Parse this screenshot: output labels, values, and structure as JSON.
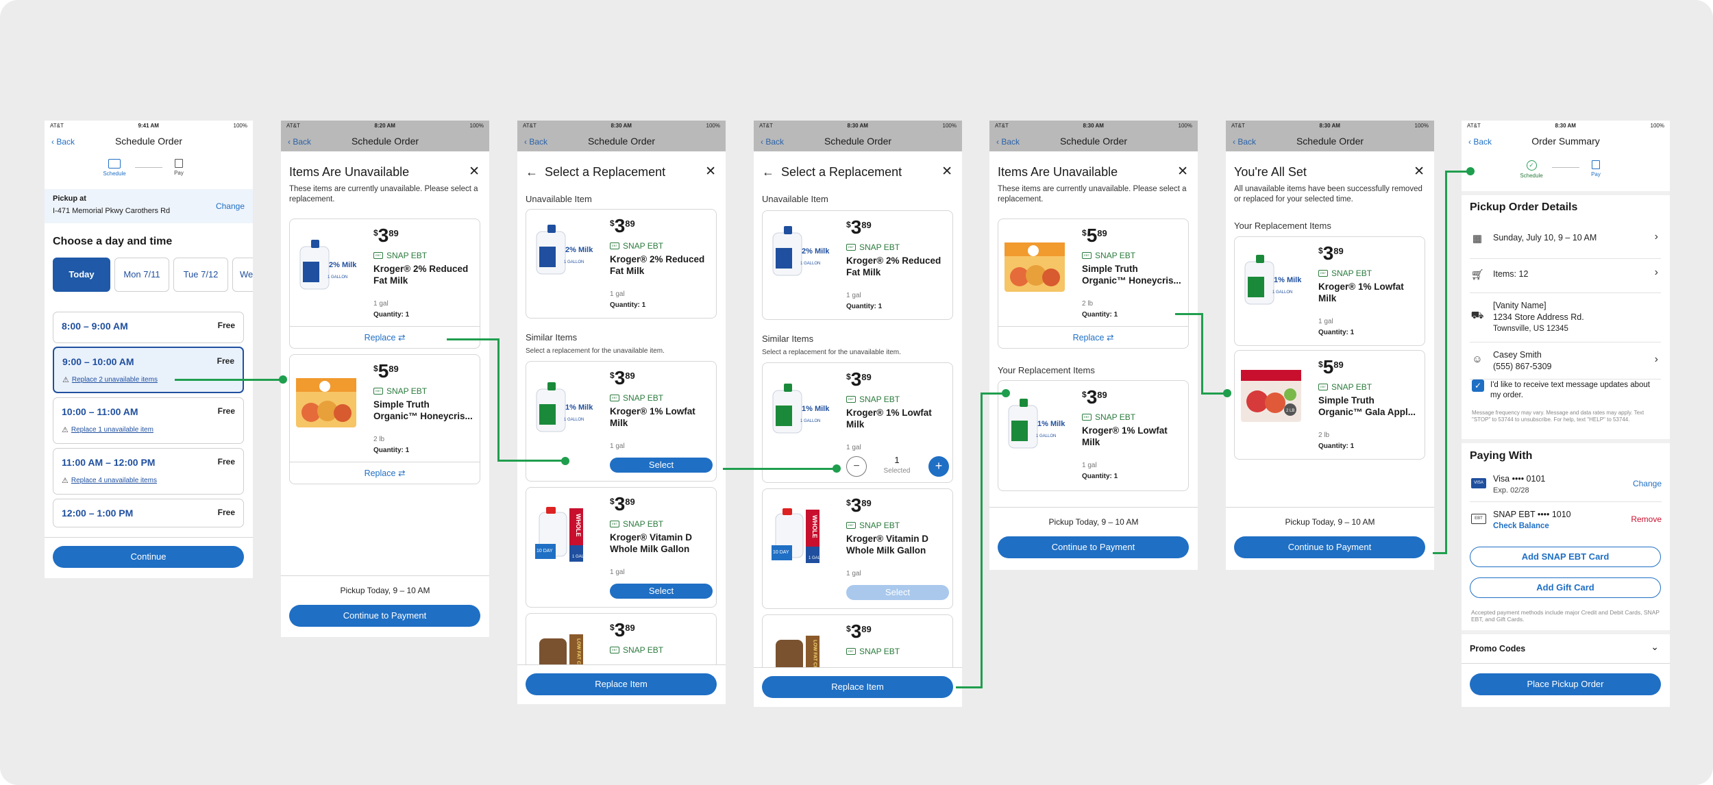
{
  "status": {
    "carrier": "AT&T",
    "battery": "100%",
    "time_first": "9:41 AM",
    "time_second": "8:20 AM",
    "time_rest": "8:30 AM"
  },
  "nav": {
    "back": "Back",
    "schedule_order": "Schedule Order",
    "order_summary": "Order Summary"
  },
  "steps": {
    "schedule": "Schedule",
    "pay": "Pay"
  },
  "screen1": {
    "pickup_label": "Pickup at",
    "pickup_address": "I-471 Memorial Pkwy Carothers Rd",
    "change": "Change",
    "heading": "Choose a day and time",
    "days": [
      "Today",
      "Mon 7/11",
      "Tue 7/12",
      "We"
    ],
    "slots": [
      {
        "time": "8:00 – 9:00 AM",
        "fee": "Free",
        "warning": ""
      },
      {
        "time": "9:00 – 10:00 AM",
        "fee": "Free",
        "warning": "Replace 2 unavailable items"
      },
      {
        "time": "10:00 – 11:00 AM",
        "fee": "Free",
        "warning": "Replace 1 unavailable item"
      },
      {
        "time": "11:00 AM – 12:00 PM",
        "fee": "Free",
        "warning": "Replace 4 unavailable items"
      },
      {
        "time": "12:00 – 1:00 PM",
        "fee": "Free",
        "warning": ""
      }
    ],
    "continue": "Continue"
  },
  "screen2": {
    "title": "Items Are Unavailable",
    "subtitle": "These items are currently unavailable. Please select a replacement.",
    "items": [
      {
        "dollars": "3",
        "cents": "89",
        "snap": "SNAP EBT",
        "name": "Kroger® 2% Reduced Fat Milk",
        "size": "1 gal",
        "qty": "Quantity: 1",
        "action": "Replace"
      },
      {
        "dollars": "5",
        "cents": "89",
        "snap": "SNAP EBT",
        "name": "Simple Truth Organic™ Honeycris...",
        "size": "2 lb",
        "qty": "Quantity: 1",
        "action": "Replace"
      }
    ],
    "pickup": "Pickup Today, 9 – 10 AM",
    "cta": "Continue to Payment"
  },
  "screen3": {
    "title": "Select a Replacement",
    "unavailable": "Unavailable Item",
    "similar": "Similar Items",
    "similar_sub": "Select a replacement for the unavailable item.",
    "unavail_item": {
      "dollars": "3",
      "cents": "89",
      "snap": "SNAP EBT",
      "name": "Kroger® 2% Reduced Fat Milk",
      "size": "1 gal",
      "qty": "Quantity: 1"
    },
    "options": [
      {
        "dollars": "3",
        "cents": "89",
        "snap": "SNAP EBT",
        "name": "Kroger® 1% Lowfat Milk",
        "size": "1 gal",
        "btn": "Select"
      },
      {
        "dollars": "3",
        "cents": "89",
        "snap": "SNAP EBT",
        "name": "Kroger® Vitamin D Whole Milk Gallon",
        "size": "1 gal",
        "btn": "Select"
      },
      {
        "dollars": "3",
        "cents": "89",
        "snap": "SNAP EBT"
      }
    ],
    "cta": "Replace Item"
  },
  "screen4": {
    "stepper_value": "1",
    "stepper_label": "Selected",
    "disabled_select": "Select"
  },
  "screen5": {
    "title": "Items Are Unavailable",
    "subtitle": "These items are currently unavailable. Please select a replacement.",
    "item": {
      "dollars": "5",
      "cents": "89",
      "snap": "SNAP EBT",
      "name": "Simple Truth Organic™ Honeycris...",
      "size": "2 lb",
      "qty": "Quantity: 1",
      "action": "Replace"
    },
    "your_repl": "Your Replacement Items",
    "repl_item": {
      "dollars": "3",
      "cents": "89",
      "snap": "SNAP EBT",
      "name": "Kroger® 1% Lowfat Milk",
      "size": "1 gal",
      "qty": "Quantity: 1"
    },
    "pickup": "Pickup Today, 9 – 10 AM",
    "cta": "Continue to Payment"
  },
  "screen6": {
    "title": "You're All Set",
    "subtitle": "All unavailable items have been successfully removed or replaced for your selected time.",
    "your_repl": "Your Replacement Items",
    "items": [
      {
        "dollars": "3",
        "cents": "89",
        "snap": "SNAP EBT",
        "name": "Kroger® 1% Lowfat Milk",
        "size": "1 gal",
        "qty": "Quantity: 1"
      },
      {
        "dollars": "5",
        "cents": "89",
        "snap": "SNAP EBT",
        "name": "Simple Truth Organic™ Gala Appl...",
        "size": "2 lb",
        "qty": "Quantity: 1"
      }
    ],
    "pickup": "Pickup Today, 9 – 10 AM",
    "cta": "Continue to Payment"
  },
  "screen7": {
    "details": "Pickup Order Details",
    "date": "Sunday, July 10, 9 – 10 AM",
    "items": "Items: 12",
    "store_name": "[Vanity Name]",
    "store_addr1": "1234 Store Address Rd.",
    "store_addr2": "Townsville, US 12345",
    "contact_name": "Casey Smith",
    "contact_phone": "(555) 867-5309",
    "sms_label": "I'd like to receive text message updates about my order.",
    "sms_fine": "Message frequency may vary. Message and data rates may apply. Text \"STOP\" to 53744 to unsubscribe. For help, text \"HELP\" to 53744.",
    "paying": "Paying With",
    "visa": "Visa •••• 0101",
    "visa_exp": "Exp. 02/28",
    "visa_action": "Change",
    "visa_badge": "VISA",
    "ebt": "SNAP EBT •••• 1010",
    "ebt_link": "Check Balance",
    "ebt_action": "Remove",
    "ebt_badge": "EBT",
    "add_ebt": "Add SNAP EBT Card",
    "add_gift": "Add Gift Card",
    "accepted": "Accepted payment methods include major Credit and Debit Cards, SNAP EBT, and Gift Cards.",
    "promo": "Promo Codes",
    "cta": "Place Pickup Order"
  },
  "images": {
    "milk_2pct": "2% Milk",
    "milk_1pct": "1% Milk",
    "milk_gallon": "1 GALLON",
    "whole": "WHOLE",
    "whole_gal": "1 GAL",
    "ten_day": "10 DAY",
    "choc": "LOW FAT CHOCOLATE",
    "apple_lb": "2 LB"
  },
  "colors": {
    "accent": "#1f6fc4",
    "accent_dark": "#1f4f9e",
    "snap_green": "#2a7a3c",
    "connector": "#1f9e4e",
    "danger": "#c8102e"
  }
}
